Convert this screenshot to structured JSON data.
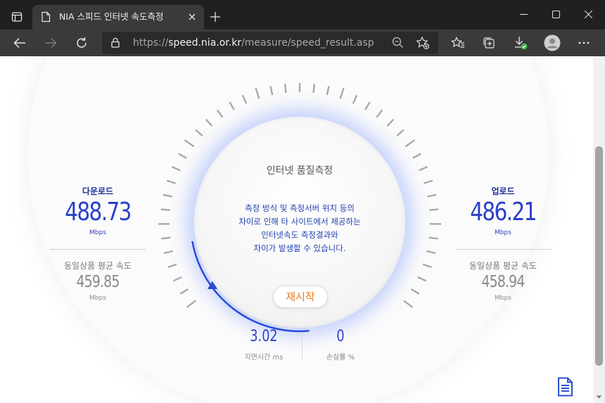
{
  "tab": {
    "title": "NIA 스피드 인터넷 속도측정"
  },
  "address_bar": {
    "protocol": "https://",
    "host": "speed.nia.or.kr",
    "path": "/measure/speed_result.asp"
  },
  "page": {
    "title": "인터넷 품질측정",
    "notice_lines": [
      "측정 방식 및 측정서버 위치 등의",
      "차이로 인해 타 사이트에서 제공하는",
      "인터넷속도 측정결과와",
      "차이가 발생할 수 있습니다."
    ],
    "restart_label": "재시작",
    "download": {
      "label": "다운로드",
      "value": "488.73",
      "unit": "Mbps",
      "avg_label": "동일상품 평균 속도",
      "avg_value": "459.85",
      "avg_unit": "Mbps"
    },
    "upload": {
      "label": "업로드",
      "value": "486.21",
      "unit": "Mbps",
      "avg_label": "동일상품 평균 속도",
      "avg_value": "458.94",
      "avg_unit": "Mbps"
    },
    "latency": {
      "value": "3.02",
      "label": "지연시간",
      "unit": "ms"
    },
    "loss": {
      "value": "0",
      "label": "손실률",
      "unit": "%"
    }
  },
  "colors": {
    "accent_blue": "#2a3fc9",
    "restart_orange": "#f07a13"
  }
}
